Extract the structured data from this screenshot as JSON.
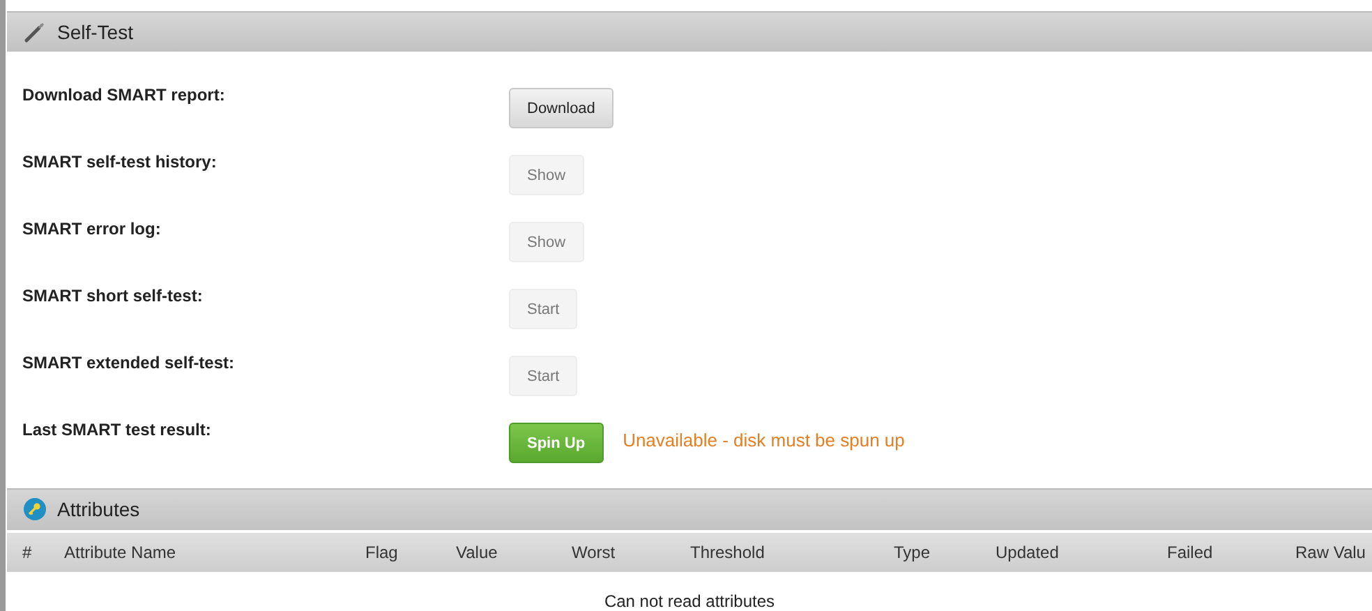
{
  "self_test": {
    "title": "Self-Test",
    "rows": [
      {
        "label": "Download SMART report:",
        "button": {
          "label": "Download",
          "kind": "default",
          "disabled": false
        }
      },
      {
        "label": "SMART self-test history:",
        "button": {
          "label": "Show",
          "kind": "default",
          "disabled": true
        }
      },
      {
        "label": "SMART error log:",
        "button": {
          "label": "Show",
          "kind": "default",
          "disabled": true
        }
      },
      {
        "label": "SMART short self-test:",
        "button": {
          "label": "Start",
          "kind": "default",
          "disabled": true
        }
      },
      {
        "label": "SMART extended self-test:",
        "button": {
          "label": "Start",
          "kind": "default",
          "disabled": true
        }
      },
      {
        "label": "Last SMART test result:",
        "button": {
          "label": "Spin Up",
          "kind": "success",
          "disabled": false
        },
        "status": "Unavailable - disk must be spun up"
      }
    ]
  },
  "attributes": {
    "title": "Attributes",
    "columns": [
      "#",
      "Attribute Name",
      "Flag",
      "Value",
      "Worst",
      "Threshold",
      "Type",
      "Updated",
      "Failed",
      "Raw Valu"
    ],
    "message": "Can not read attributes"
  }
}
